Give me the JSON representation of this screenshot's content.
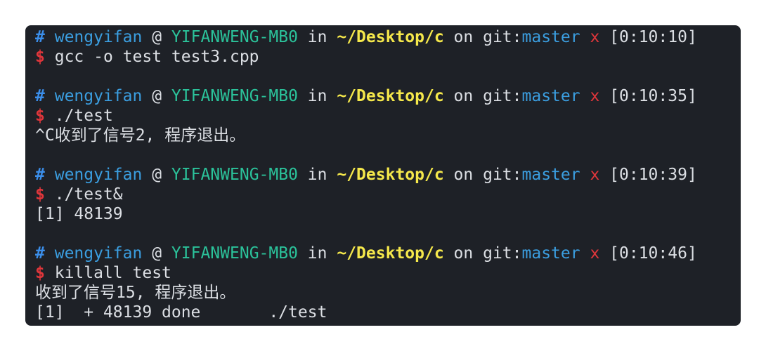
{
  "window": {
    "background": "#1e2127"
  },
  "prompt": {
    "hash_symbol": "#",
    "user": "wengyifan",
    "at": "@",
    "host": "YIFANWENG-MB0",
    "in_word": "in",
    "path": "~/Desktop/c",
    "on_word": "on",
    "git_prefix": "git:",
    "branch": "master",
    "dirty_marker": "x",
    "dollar_symbol": "$"
  },
  "blocks": [
    {
      "time": "[0:10:10]",
      "command": "gcc -o test test3.cpp",
      "output": []
    },
    {
      "time": "[0:10:35]",
      "command": "./test",
      "output": [
        "^C收到了信号2, 程序退出。"
      ]
    },
    {
      "time": "[0:10:39]",
      "command": "./test&",
      "output": [
        "[1] 48139"
      ]
    },
    {
      "time": "[0:10:46]",
      "command": "killall test",
      "output": [
        "收到了信号15, 程序退出。",
        "[1]  + 48139 done       ./test"
      ]
    }
  ],
  "colors": {
    "hash": "#3b8eea",
    "user": "#3b9ee0",
    "host": "#2bc29a",
    "path": "#f5e84b",
    "branch": "#3b9ee0",
    "dirty": "#e0363b",
    "dollar": "#e0363b",
    "text": "#dcdfe4"
  }
}
